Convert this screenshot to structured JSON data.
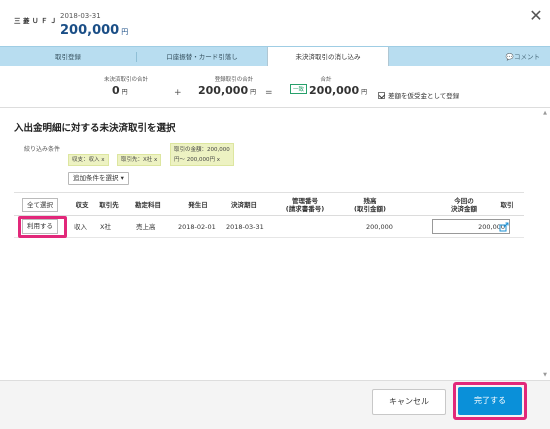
{
  "header": {
    "bank_name": "三菱ＵＦＪ",
    "date": "2018-03-31",
    "amount": "200,000",
    "currency": "円"
  },
  "tabs": [
    {
      "label": "取引登録"
    },
    {
      "label": "口座振替・カード引落し"
    },
    {
      "label": "未決済取引の消し込み",
      "active": true
    }
  ],
  "comment_label": "💬コメント",
  "summary": {
    "unsettled_label": "未決済取引の合計",
    "unsettled_value": "0",
    "registered_label": "登録取引の合計",
    "registered_value": "200,000",
    "total_label": "合計",
    "total_badge": "一致",
    "total_value": "200,000",
    "yen": "円",
    "plus": "+",
    "equals": "=",
    "checkbox_label": "差額を仮受金として登録"
  },
  "section": {
    "title": "入出金明細に対する未決済取引を選択",
    "filter_label": "絞り込み条件",
    "chips": [
      {
        "label": "収支：収入 x"
      },
      {
        "label": "取引先：X社 x"
      },
      {
        "label_line1": "取引の金額：200,000",
        "label_line2": "円～ 200,000円 x"
      }
    ],
    "add_condition": "追加条件を選択 ▾"
  },
  "table": {
    "select_all": "全て選択",
    "headers": [
      "収支",
      "取引先",
      "勘定科目",
      "発生日",
      "決済期日",
      "管理番号\n(請求書番号)",
      "残高\n(取引金額)",
      "今回の\n決済金額",
      "取引"
    ],
    "rows": [
      {
        "action": "利用する",
        "type": "収入",
        "partner": "X社",
        "account": "売上高",
        "date": "2018-02-01",
        "due": "2018-03-31",
        "ref": "",
        "balance": "200,000",
        "pay_amount": "200,000"
      }
    ]
  },
  "footer": {
    "cancel": "キャンセル",
    "complete": "完了する"
  },
  "colors": {
    "accent": "#0a90d9",
    "highlight": "#e2287a",
    "tab_bar": "#b8ddf0",
    "chip_bg": "#edf2c2",
    "link_icon": "#1b8fd2"
  }
}
